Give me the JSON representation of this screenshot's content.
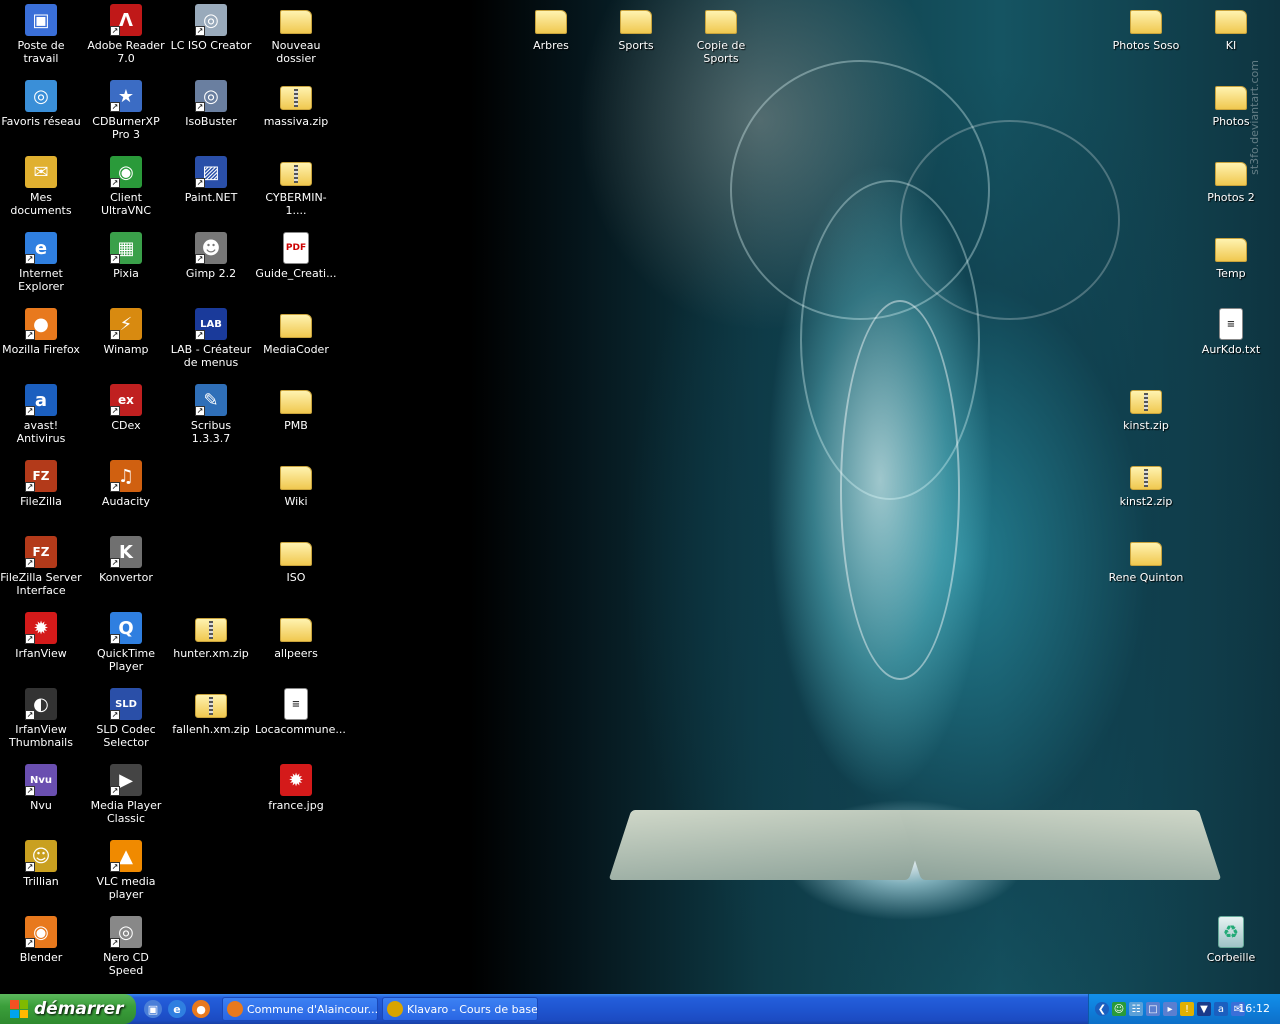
{
  "desktop": {
    "icons": [
      {
        "label": "Poste de travail",
        "icon": "my-computer-icon",
        "col": 0,
        "row": 0
      },
      {
        "label": "Favoris réseau",
        "icon": "network-places-icon",
        "col": 0,
        "row": 1
      },
      {
        "label": "Mes documents",
        "icon": "my-documents-icon",
        "col": 0,
        "row": 2
      },
      {
        "label": "Internet Explorer",
        "icon": "internet-explorer-icon",
        "col": 0,
        "row": 3
      },
      {
        "label": "Mozilla Firefox",
        "icon": "firefox-icon",
        "col": 0,
        "row": 4
      },
      {
        "label": "avast! Antivirus",
        "icon": "avast-icon",
        "col": 0,
        "row": 5
      },
      {
        "label": "FileZilla",
        "icon": "filezilla-icon",
        "col": 0,
        "row": 6
      },
      {
        "label": "FileZilla Server Interface",
        "icon": "filezilla-server-icon",
        "col": 0,
        "row": 7
      },
      {
        "label": "IrfanView",
        "icon": "irfanview-icon",
        "col": 0,
        "row": 8
      },
      {
        "label": "IrfanView Thumbnails",
        "icon": "irfanview-thumbnails-icon",
        "col": 0,
        "row": 9
      },
      {
        "label": "Nvu",
        "icon": "nvu-icon",
        "col": 0,
        "row": 10
      },
      {
        "label": "Trillian",
        "icon": "trillian-icon",
        "col": 0,
        "row": 11
      },
      {
        "label": "Blender",
        "icon": "blender-icon",
        "col": 0,
        "row": 12
      },
      {
        "label": "Adobe Reader 7.0",
        "icon": "adobe-reader-icon",
        "col": 1,
        "row": 0
      },
      {
        "label": "CDBurnerXP Pro 3",
        "icon": "cdburnerxp-icon",
        "col": 1,
        "row": 1
      },
      {
        "label": "Client UltraVNC",
        "icon": "ultravnc-icon",
        "col": 1,
        "row": 2
      },
      {
        "label": "Pixia",
        "icon": "pixia-icon",
        "col": 1,
        "row": 3
      },
      {
        "label": "Winamp",
        "icon": "winamp-icon",
        "col": 1,
        "row": 4
      },
      {
        "label": "CDex",
        "icon": "cdex-icon",
        "col": 1,
        "row": 5
      },
      {
        "label": "Audacity",
        "icon": "audacity-icon",
        "col": 1,
        "row": 6
      },
      {
        "label": "Konvertor",
        "icon": "konvertor-icon",
        "col": 1,
        "row": 7
      },
      {
        "label": "QuickTime Player",
        "icon": "quicktime-icon",
        "col": 1,
        "row": 8
      },
      {
        "label": "SLD Codec Selector",
        "icon": "sld-codec-icon",
        "col": 1,
        "row": 9
      },
      {
        "label": "Media Player Classic",
        "icon": "media-player-classic-icon",
        "col": 1,
        "row": 10
      },
      {
        "label": "VLC media player",
        "icon": "vlc-icon",
        "col": 1,
        "row": 11
      },
      {
        "label": "Nero CD Speed",
        "icon": "nero-cd-speed-icon",
        "col": 1,
        "row": 12
      },
      {
        "label": "LC ISO Creator",
        "icon": "lc-iso-creator-icon",
        "col": 2,
        "row": 0
      },
      {
        "label": "IsoBuster",
        "icon": "isobuster-icon",
        "col": 2,
        "row": 1
      },
      {
        "label": "Paint.NET",
        "icon": "paint-net-icon",
        "col": 2,
        "row": 2
      },
      {
        "label": "Gimp 2.2",
        "icon": "gimp-icon",
        "col": 2,
        "row": 3
      },
      {
        "label": "LAB - Créateur de menus",
        "icon": "lab-menu-creator-icon",
        "col": 2,
        "row": 4
      },
      {
        "label": "Scribus 1.3.3.7",
        "icon": "scribus-icon",
        "col": 2,
        "row": 5
      },
      {
        "label": "hunter.xm.zip",
        "icon": "zip-folder-icon",
        "col": 2,
        "row": 8
      },
      {
        "label": "fallenh.xm.zip",
        "icon": "zip-folder-icon",
        "col": 2,
        "row": 9
      },
      {
        "label": "Nouveau dossier",
        "icon": "folder-icon",
        "col": 3,
        "row": 0
      },
      {
        "label": "massiva.zip",
        "icon": "zip-folder-icon",
        "col": 3,
        "row": 1
      },
      {
        "label": "CYBERMIN-1....",
        "icon": "zip-folder-icon",
        "col": 3,
        "row": 2
      },
      {
        "label": "Guide_Creati...",
        "icon": "pdf-file-icon",
        "col": 3,
        "row": 3
      },
      {
        "label": "MediaCoder",
        "icon": "folder-icon",
        "col": 3,
        "row": 4
      },
      {
        "label": "PMB",
        "icon": "folder-icon",
        "col": 3,
        "row": 5
      },
      {
        "label": "Wiki",
        "icon": "folder-icon",
        "col": 3,
        "row": 6
      },
      {
        "label": "ISO",
        "icon": "folder-icon",
        "col": 3,
        "row": 7
      },
      {
        "label": "allpeers",
        "icon": "folder-icon",
        "col": 3,
        "row": 8
      },
      {
        "label": "Locacommune...",
        "icon": "text-file-icon",
        "col": 3,
        "row": 9
      },
      {
        "label": "france.jpg",
        "icon": "irfanview-image-icon",
        "col": 3,
        "row": 10
      },
      {
        "label": "Arbres",
        "icon": "folder-icon",
        "col": 6,
        "row": 0
      },
      {
        "label": "Sports",
        "icon": "shared-folder-icon",
        "col": 7,
        "row": 0
      },
      {
        "label": "Copie de Sports",
        "icon": "shared-folder-icon",
        "col": 8,
        "row": 0
      },
      {
        "label": "Photos Soso",
        "icon": "folder-icon",
        "col": 13,
        "row": 0
      },
      {
        "label": "kinst.zip",
        "icon": "zip-folder-icon",
        "col": 13,
        "row": 5
      },
      {
        "label": "kinst2.zip",
        "icon": "zip-folder-icon",
        "col": 13,
        "row": 6
      },
      {
        "label": "Rene Quinton",
        "icon": "folder-icon",
        "col": 13,
        "row": 7
      },
      {
        "label": "KI",
        "icon": "folder-icon",
        "col": 14,
        "row": 0
      },
      {
        "label": "Photos",
        "icon": "folder-icon",
        "col": 14,
        "row": 1
      },
      {
        "label": "Photos 2",
        "icon": "folder-icon",
        "col": 14,
        "row": 2
      },
      {
        "label": "Temp",
        "icon": "folder-icon",
        "col": 14,
        "row": 3
      },
      {
        "label": "AurKdo.txt",
        "icon": "text-file-icon",
        "col": 14,
        "row": 4
      },
      {
        "label": "Corbeille",
        "icon": "recycle-bin-icon",
        "col": 14,
        "row": 12
      }
    ]
  },
  "wallpaper": {
    "watermark": "st3fo.deviantart.com"
  },
  "taskbar": {
    "start_label": "démarrer",
    "quick_launch": [
      {
        "icon": "show-desktop-icon",
        "color": "#4a7fd8"
      },
      {
        "icon": "internet-explorer-icon",
        "color": "#2f7fe0"
      },
      {
        "icon": "firefox-icon",
        "color": "#e8791d"
      }
    ],
    "tasks": [
      {
        "label": "Commune d'Alaincour...",
        "icon": "firefox-icon",
        "color": "#e8791d"
      },
      {
        "label": "Klavaro - Cours de base",
        "icon": "klavaro-icon",
        "color": "#d9a400"
      }
    ],
    "tray_icons": [
      "show-hidden-chevron-icon",
      "messenger-icon",
      "network-icon",
      "display-icon",
      "volume-icon",
      "security-warning-icon",
      "shield-icon",
      "antivirus-icon",
      "mail-icon"
    ],
    "clock": "16:12"
  },
  "colors": {
    "taskbar_blue": "#245edb",
    "start_green": "#3b9f3b",
    "tray_blue": "#0f7fdb",
    "folder_yellow": "#f0c850"
  }
}
